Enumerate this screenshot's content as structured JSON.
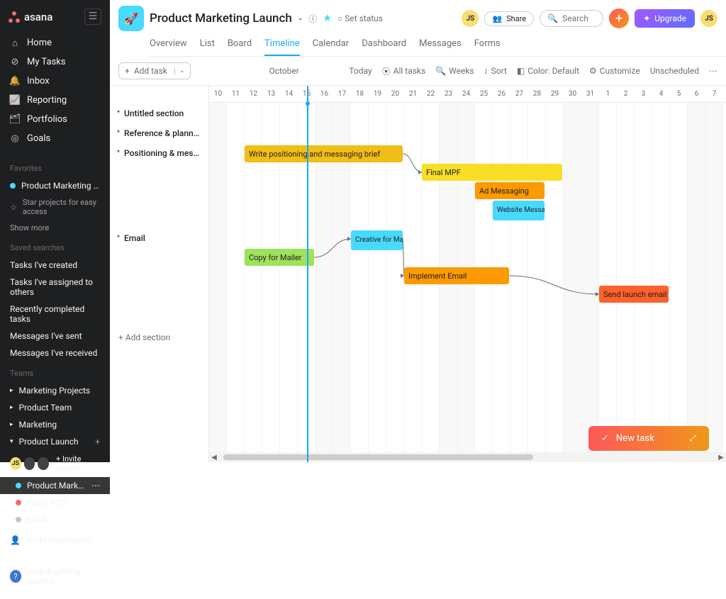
{
  "app": {
    "name": "asana"
  },
  "user": {
    "initials": "JS"
  },
  "sidebar": {
    "nav": [
      {
        "label": "Home",
        "icon": "home"
      },
      {
        "label": "My Tasks",
        "icon": "check-circle"
      },
      {
        "label": "Inbox",
        "icon": "bell"
      },
      {
        "label": "Reporting",
        "icon": "chart"
      },
      {
        "label": "Portfolios",
        "icon": "briefcase"
      },
      {
        "label": "Goals",
        "icon": "target"
      }
    ],
    "favorites_label": "Favorites",
    "favorites": [
      {
        "label": "Product Marketing Lau...",
        "color": "#48dafd"
      }
    ],
    "star_hint": "Star projects for easy access",
    "show_more": "Show more",
    "saved_label": "Saved searches",
    "saved": [
      "Tasks I've created",
      "Tasks I've assigned to others",
      "Recently completed tasks",
      "Messages I've sent",
      "Messages I've received"
    ],
    "teams_label": "Teams",
    "teams": [
      {
        "label": "Marketing Projects"
      },
      {
        "label": "Product Team"
      },
      {
        "label": "Marketing"
      },
      {
        "label": "Product Launch"
      }
    ],
    "invite_people_label": "+ Invite people",
    "team_projects": [
      {
        "label": "Product Marketing Lau...",
        "color": "#48dafd",
        "active": true
      },
      {
        "label": "Team PTO",
        "color": "#f06a6a"
      },
      {
        "label": "blank",
        "color": "#c7c4c4"
      }
    ],
    "invite_teammates": "Invite teammates",
    "help_label": "Help & getting started"
  },
  "header": {
    "project_title": "Product Marketing Launch",
    "set_status": "Set status",
    "share": "Share",
    "search_placeholder": "Search",
    "upgrade": "Upgrade",
    "tabs": [
      "Overview",
      "List",
      "Board",
      "Timeline",
      "Calendar",
      "Dashboard",
      "Messages",
      "Forms"
    ],
    "active_tab": "Timeline"
  },
  "toolbar": {
    "add_task": "Add task",
    "month_label": "October",
    "buttons": {
      "today": "Today",
      "all_tasks": "All tasks",
      "weeks": "Weeks",
      "sort": "Sort",
      "color": "Color: Default",
      "customize": "Customize",
      "unscheduled": "Unscheduled"
    }
  },
  "timeline": {
    "days": [
      "10",
      "11",
      "12",
      "13",
      "14",
      "15",
      "16",
      "17",
      "18",
      "19",
      "20",
      "21",
      "22",
      "23",
      "24",
      "25",
      "26",
      "27",
      "28",
      "29",
      "30",
      "31",
      "1",
      "2",
      "3",
      "4",
      "5",
      "6",
      "7"
    ],
    "today_index": 5,
    "weekend_indices": [
      0,
      6,
      7,
      13,
      14,
      20,
      21,
      27,
      28
    ],
    "sections": [
      {
        "name": "Untitled section"
      },
      {
        "name": "Reference & planni..."
      },
      {
        "name": "Positioning & mess..."
      },
      {
        "name": "Email"
      }
    ],
    "add_section": "Add section",
    "bars": [
      {
        "id": "b1",
        "label": "Write positioning and messaging brief",
        "section": 2,
        "row": 0,
        "start": 2,
        "span": 9,
        "color": "#f1bd16"
      },
      {
        "id": "b2",
        "label": "Final MPF",
        "section": 2,
        "row": 1,
        "start": 12,
        "span": 8,
        "color": "#f8df25"
      },
      {
        "id": "b3",
        "label": "Ad Messaging",
        "section": 2,
        "row": 2,
        "start": 15,
        "span": 4,
        "color": "#fd9a00"
      },
      {
        "id": "b4",
        "label": "Website Messaging",
        "section": 2,
        "row": 3,
        "start": 16,
        "span": 3,
        "color": "#48dafd"
      },
      {
        "id": "b5",
        "label": "Creative for Mailer",
        "section": 3,
        "row": 0,
        "start": 8,
        "span": 3,
        "color": "#48dafd"
      },
      {
        "id": "b6",
        "label": "Copy for Mailer",
        "section": 3,
        "row": 1,
        "start": 2,
        "span": 4,
        "color": "#9ee25a"
      },
      {
        "id": "b7",
        "label": "Implement Email",
        "section": 3,
        "row": 2,
        "start": 11,
        "span": 6,
        "color": "#fd9a00"
      },
      {
        "id": "b8",
        "label": "Send launch email",
        "section": 3,
        "row": 3,
        "start": 22,
        "span": 4,
        "color": "#fd612c"
      }
    ],
    "connectors": [
      {
        "from": "b1",
        "to": "b2"
      },
      {
        "from": "b6",
        "to": "b5"
      },
      {
        "from": "b5",
        "to": "b7"
      },
      {
        "from": "b7",
        "to": "b8"
      }
    ]
  },
  "fab": {
    "label": "New task"
  }
}
